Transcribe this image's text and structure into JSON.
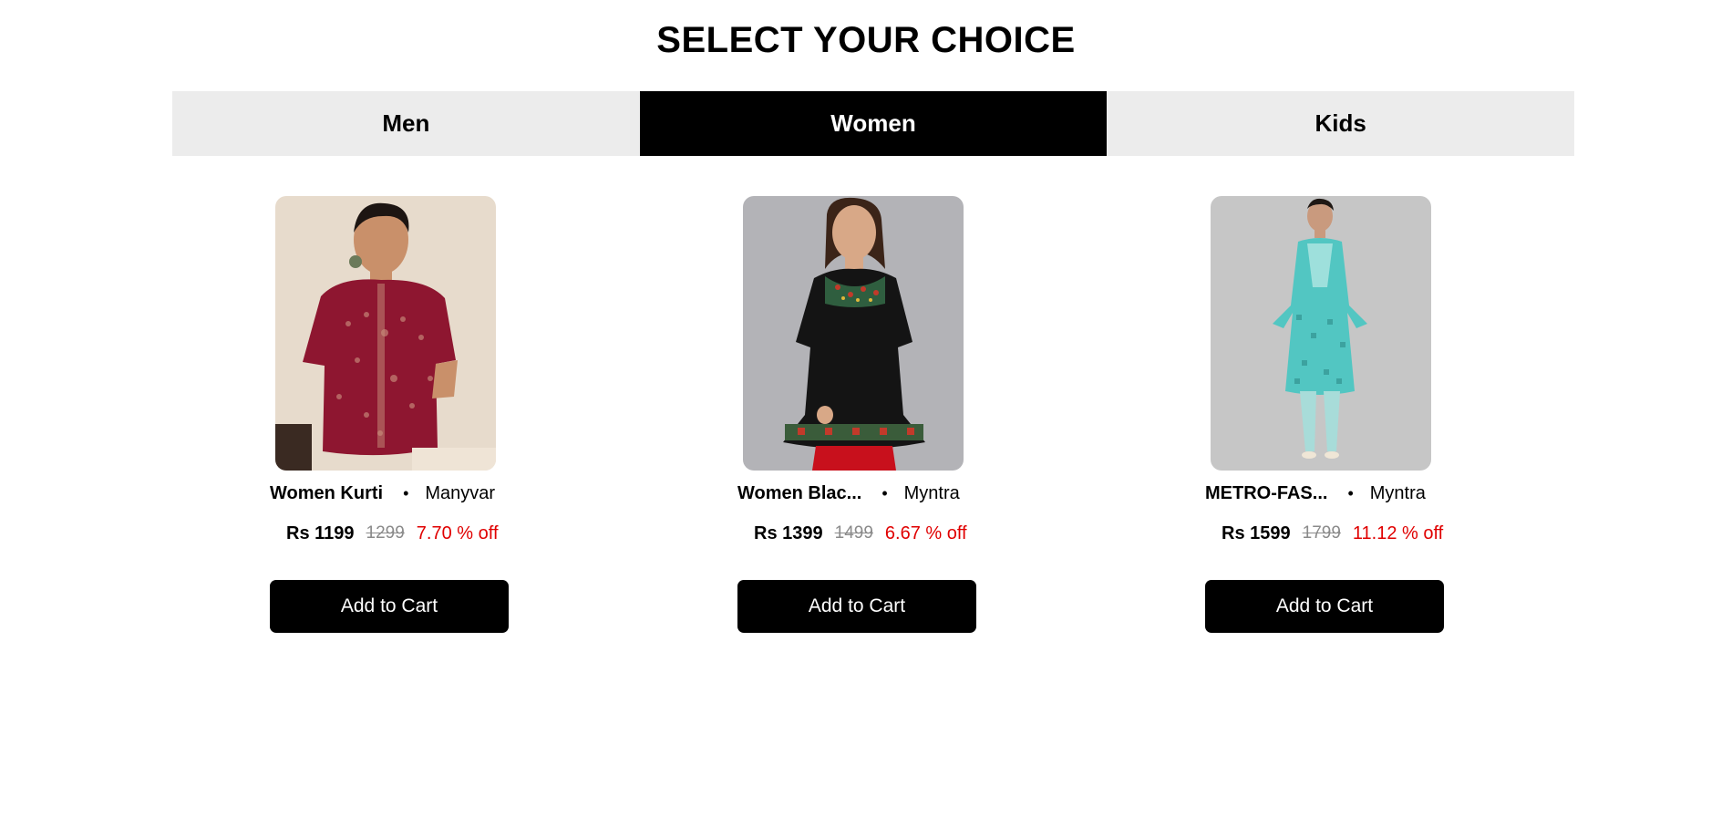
{
  "header": {
    "title": "SELECT YOUR CHOICE"
  },
  "tabs": [
    {
      "label": "Men",
      "active": false
    },
    {
      "label": "Women",
      "active": true
    },
    {
      "label": "Kids",
      "active": false
    }
  ],
  "products": [
    {
      "name": "Women Kurti",
      "brand": "Manyvar",
      "separator": "•",
      "price": "Rs 1199",
      "mrp": "1299",
      "discount": "7.70 % off",
      "button_label": "Add to Cart",
      "image": {
        "subject": "woman in maroon printed kurti",
        "bg": "#e7dbcc",
        "garment": "#8e1630"
      }
    },
    {
      "name": "Women Blac...",
      "brand": "Myntra",
      "separator": "•",
      "price": "Rs 1399",
      "mrp": "1499",
      "discount": "6.67 % off",
      "button_label": "Add to Cart",
      "image": {
        "subject": "woman in black kurti with red pants",
        "bg": "#b3b3b7",
        "garment": "#141414"
      }
    },
    {
      "name": "METRO-FAS...",
      "brand": "Myntra",
      "separator": "•",
      "price": "Rs 1599",
      "mrp": "1799",
      "discount": "11.12 % off",
      "button_label": "Add to Cart",
      "image": {
        "subject": "woman in turquoise kurta set",
        "bg": "#c6c6c6",
        "garment": "#52c6c2"
      }
    }
  ],
  "colors": {
    "tab_inactive": "#ececec",
    "tab_active": "#000000",
    "discount": "#e00000",
    "mrp": "#8a8a8a",
    "button": "#000000"
  }
}
